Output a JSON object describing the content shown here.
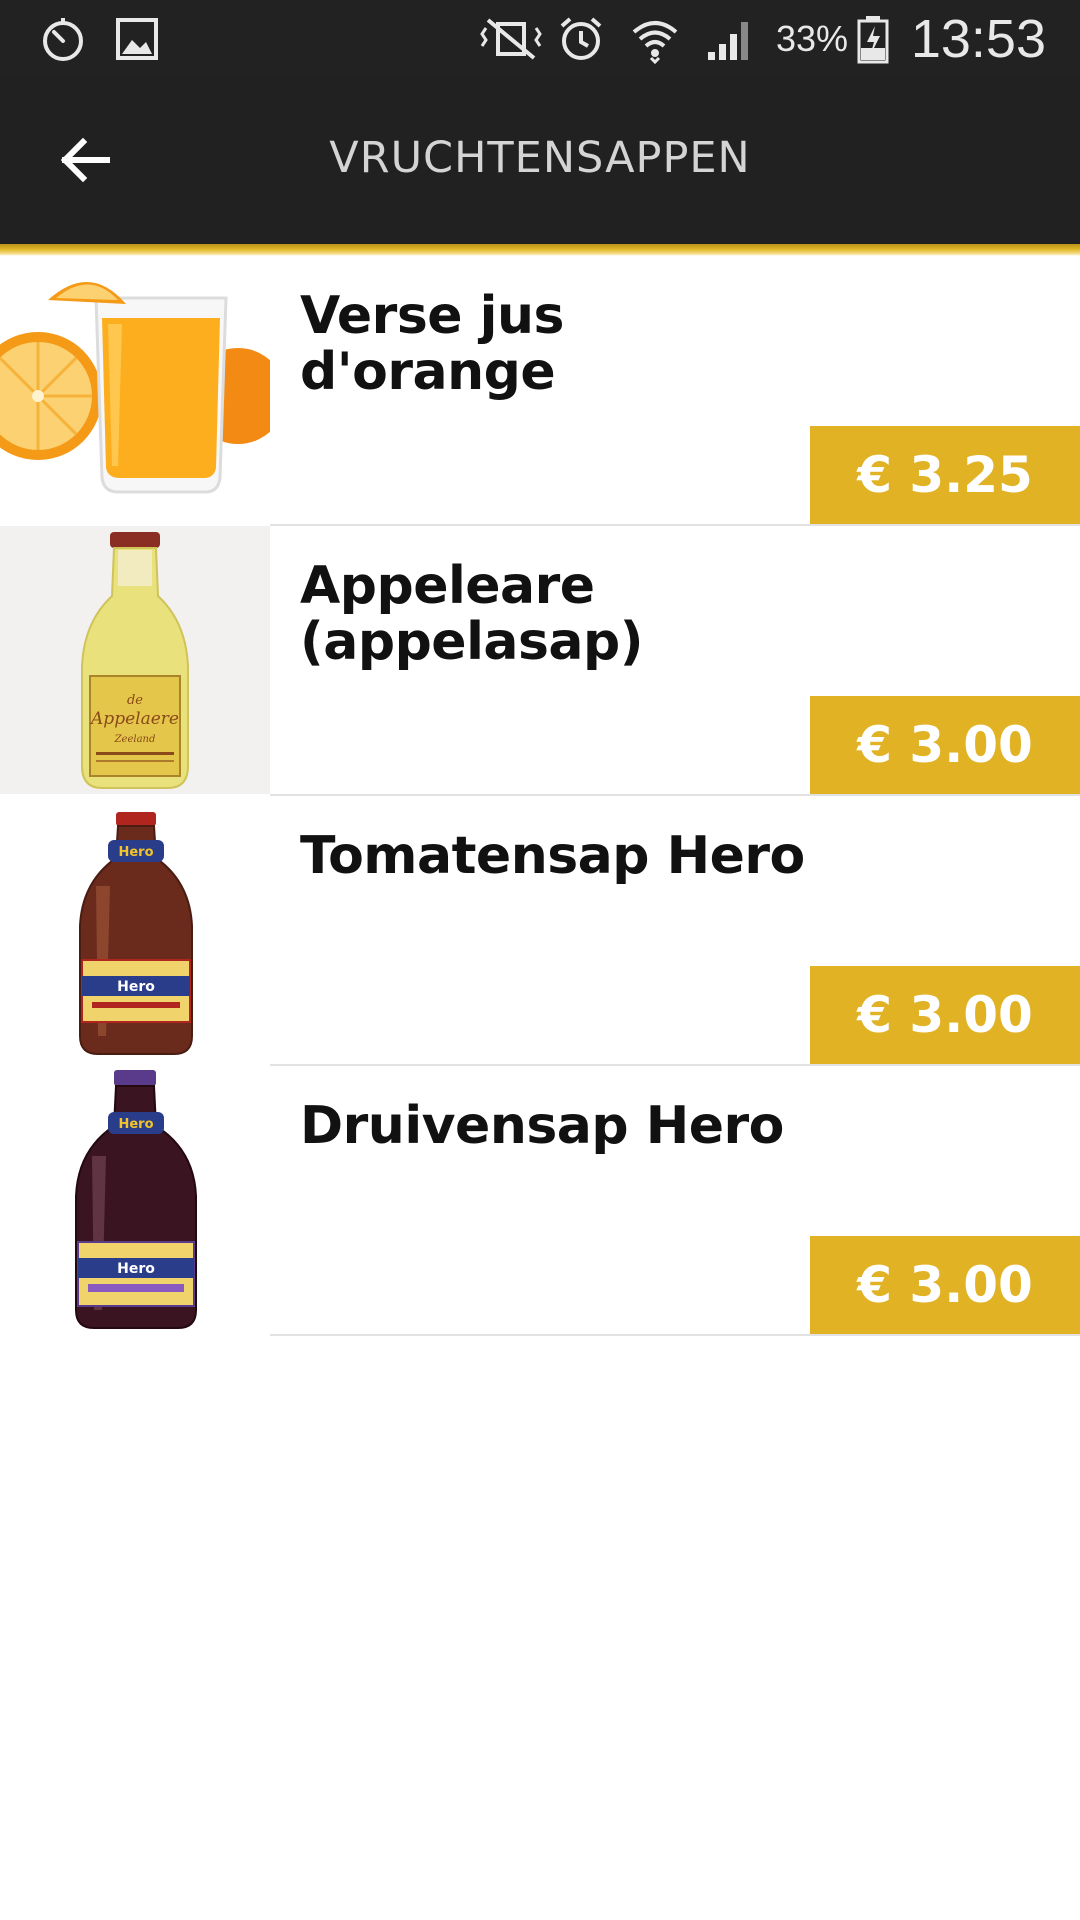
{
  "status_bar": {
    "icons": [
      "timer-icon",
      "image-icon",
      "vibrate-icon",
      "alarm-icon",
      "wifi-icon",
      "signal-icon",
      "battery-icon"
    ],
    "battery_percent": "33%",
    "time": "13:53"
  },
  "app_bar": {
    "back_icon": "arrow-left-icon",
    "title": "VRUCHTENSAPPEN"
  },
  "colors": {
    "app_bar": "#212121",
    "accent_gold": "#e0b224",
    "divider": "#e2e2e2",
    "text": "#111111"
  },
  "products": [
    {
      "name": "Verse jus d'orange",
      "price": "€ 3.25",
      "image": "orange-juice-glass"
    },
    {
      "name": "Appeleare (appelasap)",
      "price": "€ 3.00",
      "image": "apple-juice-bottle"
    },
    {
      "name": "Tomatensap Hero",
      "price": "€ 3.00",
      "image": "tomato-juice-bottle"
    },
    {
      "name": "Druivensap Hero",
      "price": "€ 3.00",
      "image": "grape-juice-bottle"
    }
  ]
}
